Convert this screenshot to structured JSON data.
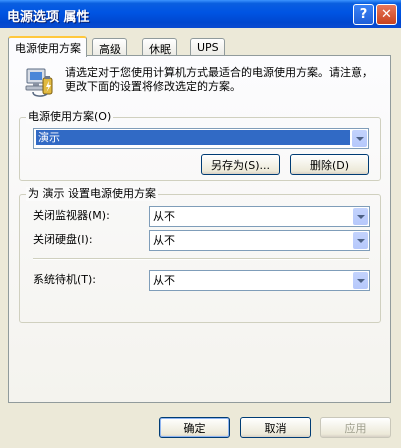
{
  "window": {
    "title": "电源选项 属性",
    "help_label": "?",
    "close_label": "✕"
  },
  "tabs": [
    {
      "label": "电源使用方案",
      "active": true
    },
    {
      "label": "高级",
      "active": false
    },
    {
      "label": "休眠",
      "active": false
    },
    {
      "label": "UPS",
      "active": false
    }
  ],
  "intro_text": "请选定对于您使用计算机方式最适合的电源使用方案。请注意，更改下面的设置将修改选定的方案。",
  "schemes": {
    "group_label": "电源使用方案(O)",
    "selected": "演示",
    "save_as_label": "另存为(S)...",
    "delete_label": "删除(D)"
  },
  "settings": {
    "group_label": "为 演示 设置电源使用方案",
    "monitor": {
      "label": "关闭监视器(M):",
      "value": "从不"
    },
    "hdd": {
      "label": "关闭硬盘(I):",
      "value": "从不"
    },
    "standby": {
      "label": "系统待机(T):",
      "value": "从不"
    }
  },
  "footer": {
    "ok_label": "确定",
    "cancel_label": "取消",
    "apply_label": "应用"
  },
  "colors": {
    "title_bar": "#0054e3",
    "selection": "#316ac5",
    "dialog_bg": "#ece9d8"
  },
  "icons": {
    "power_scheme": "power-scheme-icon"
  }
}
